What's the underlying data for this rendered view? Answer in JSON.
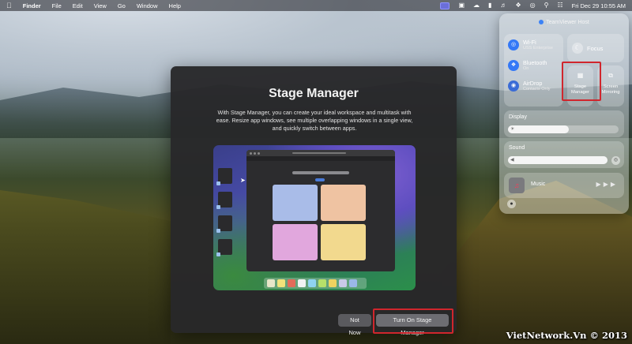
{
  "menubar": {
    "apple_icon": "apple-logo",
    "app_name": "Finder",
    "menus": [
      "File",
      "Edit",
      "View",
      "Go",
      "Window",
      "Help"
    ],
    "datetime": "Fri Dec 29  10:55 AM"
  },
  "dialog": {
    "title": "Stage Manager",
    "description": "With Stage Manager, you can create your ideal workspace and multitask with ease. Resize app windows, see multiple overlapping windows in a single view, and quickly switch between apps.",
    "not_now_label": "Not Now",
    "turn_on_label": "Turn On Stage Manager"
  },
  "control_center": {
    "host_label": "TeamViewer Host",
    "wifi": {
      "label": "Wi-Fi",
      "status": "USS Enterprise"
    },
    "bluetooth": {
      "label": "Bluetooth",
      "status": "On"
    },
    "airdrop": {
      "label": "AirDrop",
      "status": "Contacts Only"
    },
    "focus_label": "Focus",
    "stage_manager_label": "Stage Manager",
    "screen_mirroring_label": "Screen Mirroring",
    "display_label": "Display",
    "display_level": 0.55,
    "sound_label": "Sound",
    "sound_level": 1.0,
    "music_label": "Music"
  },
  "watermark": "VietNetwork.Vn © 2013",
  "colors": {
    "highlight": "#d0262d",
    "accent": "#3478f6"
  }
}
